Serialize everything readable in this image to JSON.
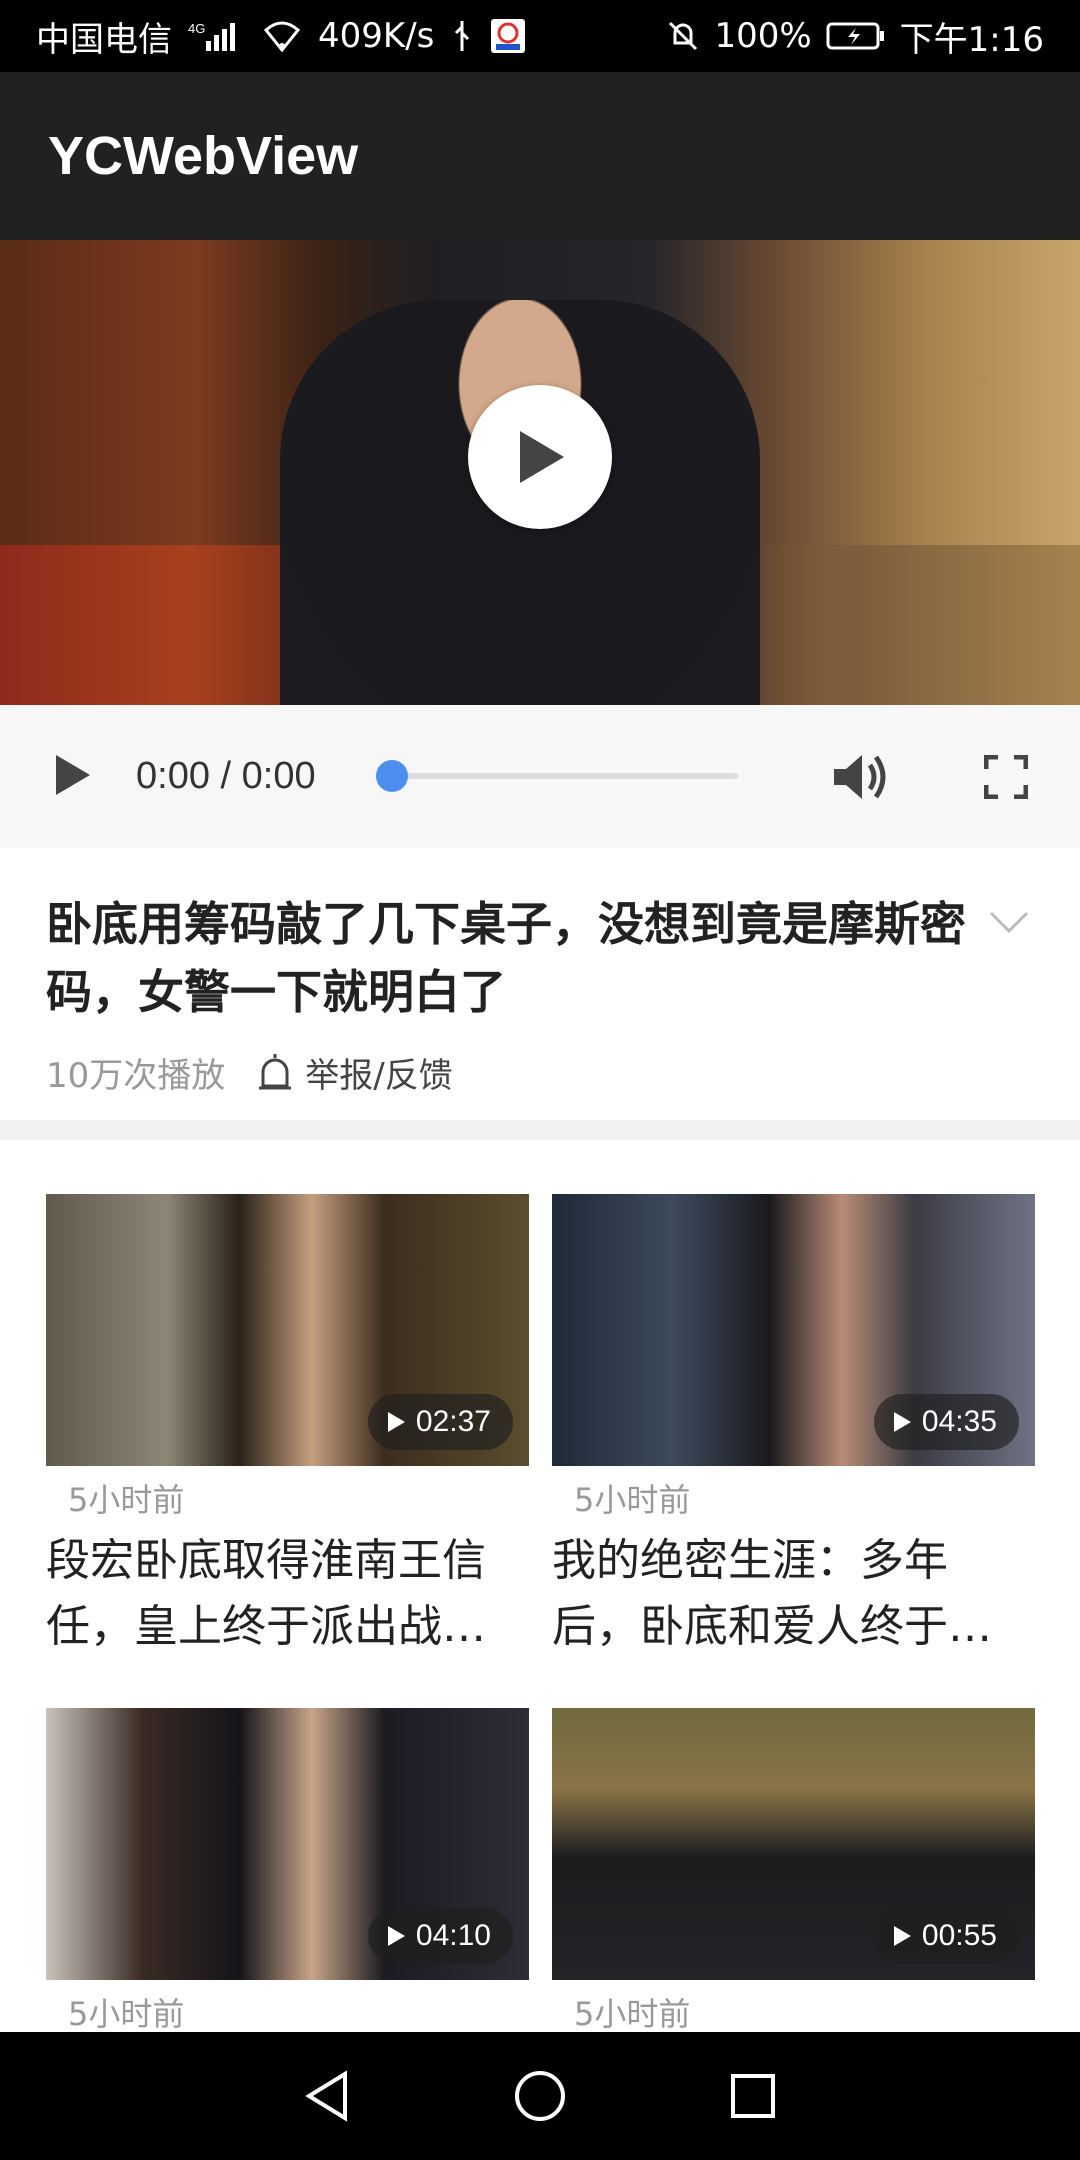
{
  "status_bar": {
    "carrier": "中国电信",
    "network": "4G",
    "speed": "409K/s",
    "battery": "100%",
    "time": "下午1:16"
  },
  "app_bar": {
    "title": "YCWebView"
  },
  "player": {
    "time_display": "0:00 / 0:00",
    "progress": 0.0
  },
  "video": {
    "title": "卧底用筹码敲了几下桌子，没想到竟是摩斯密码，女警一下就明白了",
    "plays": "10万次播放",
    "report_label": "举报/反馈"
  },
  "related": [
    {
      "duration": "02:37",
      "age": "5小时前",
      "title": "段宏卧底取得淮南王信任，皇上终于派出战…"
    },
    {
      "duration": "04:35",
      "age": "5小时前",
      "title": "我的绝密生涯：多年后，卧底和爱人终于…"
    },
    {
      "duration": "04:10",
      "age": "5小时前",
      "title": ""
    },
    {
      "duration": "00:55",
      "age": "5小时前",
      "title": ""
    }
  ],
  "colors": {
    "accent": "#4d8ff0",
    "appbar": "#212121"
  }
}
